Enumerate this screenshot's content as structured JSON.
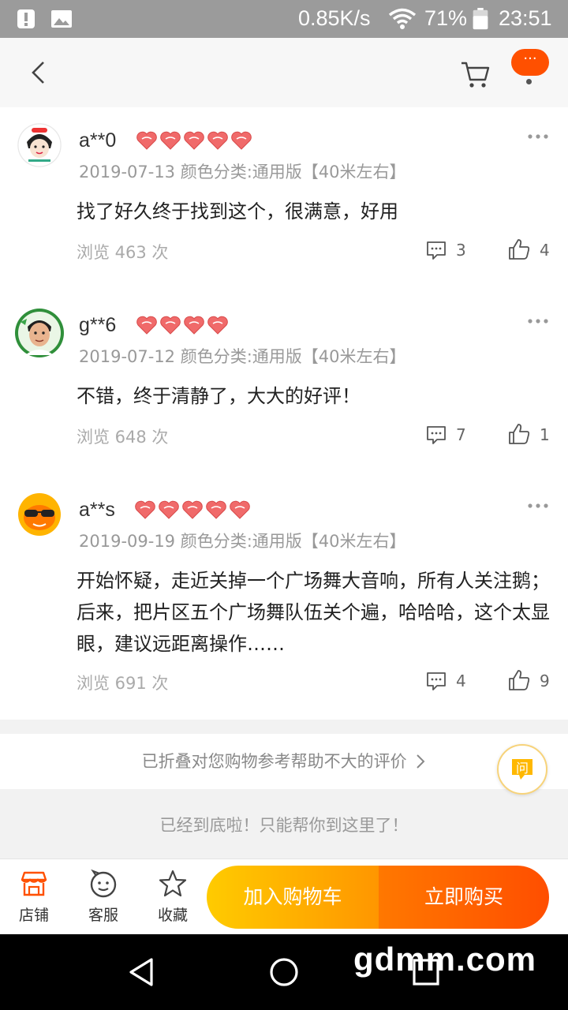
{
  "statusbar": {
    "network_speed": "0.85K/s",
    "battery": "71%",
    "time": "23:51",
    "icons": [
      "alert-icon",
      "image-icon",
      "wifi-icon",
      "battery-icon"
    ]
  },
  "header": {
    "more_label": "···",
    "icons": [
      "back-icon",
      "cart-icon",
      "more-icon"
    ]
  },
  "reviews": [
    {
      "user": "a**0",
      "hearts": 5,
      "meta": "2019-07-13 颜色分类:通用版【40米左右】",
      "content": "找了好久终于找到这个，很满意，好用",
      "views": "浏览 463 次",
      "comments": "3",
      "likes": "4"
    },
    {
      "user": "g**6",
      "hearts": 4,
      "meta": "2019-07-12 颜色分类:通用版【40米左右】",
      "content": "不错，终于清静了，大大的好评！",
      "views": "浏览 648 次",
      "comments": "7",
      "likes": "1"
    },
    {
      "user": "a**s",
      "hearts": 5,
      "meta": "2019-09-19 颜色分类:通用版【40米左右】",
      "content": "开始怀疑，走近关掉一个广场舞大音响，所有人关注鹅；后来，把片区五个广场舞队伍关个遍，哈哈哈，这个太显眼，建议远距离操作……",
      "views": "浏览 691 次",
      "comments": "4",
      "likes": "9"
    }
  ],
  "folded": {
    "label": "已折叠对您购物参考帮助不大的评价"
  },
  "ask_button": {
    "label": "问"
  },
  "end_message": "已经到底啦！只能帮你到这里了！",
  "bottom_bar": {
    "shop_label": "店铺",
    "service_label": "客服",
    "favorite_label": "收藏",
    "add_to_cart_label": "加入购物车",
    "buy_now_label": "立即购买"
  },
  "watermark": "gdmm.com",
  "colors": {
    "brand_orange": "#ff5000",
    "cart_button": "#ffa800",
    "buy_button": "#ff5a00",
    "heart_red": "#f06a6a"
  }
}
